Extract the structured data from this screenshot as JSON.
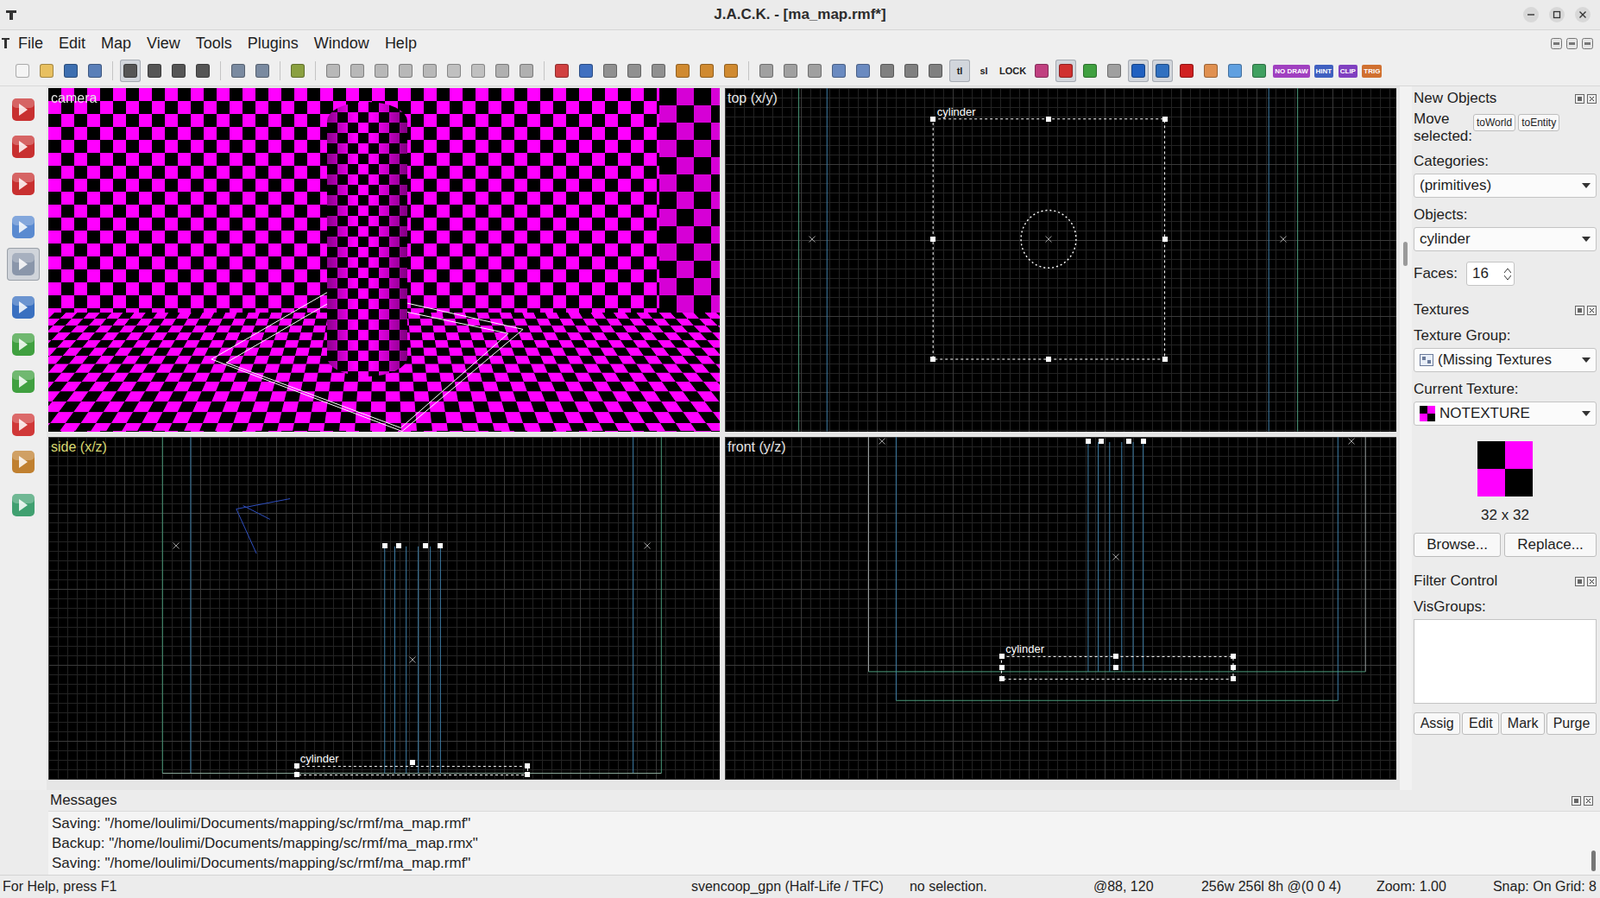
{
  "window": {
    "title": "J.A.C.K. - [ma_map.rmf*]"
  },
  "menu": [
    "File",
    "Edit",
    "Map",
    "View",
    "Tools",
    "Plugins",
    "Window",
    "Help"
  ],
  "toolbar": [
    {
      "kind": "icon",
      "color": "#f4f4f4",
      "selected": false
    },
    {
      "kind": "icon",
      "color": "#e8c060",
      "selected": false
    },
    {
      "kind": "icon",
      "color": "#3d6fb0",
      "selected": false
    },
    {
      "kind": "icon",
      "color": "#5a7fb8",
      "selected": false
    },
    {
      "kind": "sep"
    },
    {
      "kind": "icon",
      "color": "#555555",
      "selected": true
    },
    {
      "kind": "icon",
      "color": "#555555",
      "selected": false
    },
    {
      "kind": "icon",
      "color": "#555555",
      "selected": false
    },
    {
      "kind": "icon",
      "color": "#555555",
      "selected": false
    },
    {
      "kind": "sep"
    },
    {
      "kind": "icon",
      "color": "#7a8aa0",
      "selected": false
    },
    {
      "kind": "icon",
      "color": "#7a8aa0",
      "selected": false
    },
    {
      "kind": "sep"
    },
    {
      "kind": "icon",
      "color": "#8aa040",
      "selected": false
    },
    {
      "kind": "sep"
    },
    {
      "kind": "icon",
      "color": "#b8b8b8",
      "selected": false
    },
    {
      "kind": "icon",
      "color": "#b8b8b8",
      "selected": false
    },
    {
      "kind": "icon",
      "color": "#b8b8b8",
      "selected": false
    },
    {
      "kind": "icon",
      "color": "#b8b8b8",
      "selected": false
    },
    {
      "kind": "icon",
      "color": "#b8b8b8",
      "selected": false
    },
    {
      "kind": "icon",
      "color": "#c0c0c0",
      "selected": false
    },
    {
      "kind": "icon",
      "color": "#c0c0c0",
      "selected": false
    },
    {
      "kind": "icon",
      "color": "#b0b0b0",
      "selected": false
    },
    {
      "kind": "icon",
      "color": "#b0b0b0",
      "selected": false
    },
    {
      "kind": "sep"
    },
    {
      "kind": "icon",
      "color": "#d04040",
      "selected": false
    },
    {
      "kind": "icon",
      "color": "#4070c0",
      "selected": false
    },
    {
      "kind": "icon",
      "color": "#909090",
      "selected": false
    },
    {
      "kind": "icon",
      "color": "#909090",
      "selected": false
    },
    {
      "kind": "icon",
      "color": "#909090",
      "selected": false
    },
    {
      "kind": "icon",
      "color": "#d08a30",
      "selected": false
    },
    {
      "kind": "icon",
      "color": "#d08a30",
      "selected": false
    },
    {
      "kind": "icon",
      "color": "#d08a30",
      "selected": false
    },
    {
      "kind": "sep"
    },
    {
      "kind": "icon",
      "color": "#a0a0a0",
      "selected": false
    },
    {
      "kind": "icon",
      "color": "#a0a0a0",
      "selected": false
    },
    {
      "kind": "icon",
      "color": "#a0a0a0",
      "selected": false
    },
    {
      "kind": "icon",
      "color": "#6a8ac0",
      "selected": false
    },
    {
      "kind": "icon",
      "color": "#6a8ac0",
      "selected": false
    },
    {
      "kind": "icon",
      "color": "#808080",
      "selected": false
    },
    {
      "kind": "icon",
      "color": "#808080",
      "selected": false
    },
    {
      "kind": "icon",
      "color": "#808080",
      "selected": false
    },
    {
      "kind": "glyph",
      "label": "tl",
      "color": "#222222",
      "selected": true
    },
    {
      "kind": "glyph",
      "label": "sl",
      "color": "#222222",
      "selected": false
    },
    {
      "kind": "glyph",
      "label": "LOCK",
      "color": "#222222",
      "selected": false
    },
    {
      "kind": "icon",
      "color": "#c04080",
      "selected": false
    },
    {
      "kind": "icon",
      "color": "#d03030",
      "selected": true
    },
    {
      "kind": "icon",
      "color": "#40a040",
      "selected": false
    },
    {
      "kind": "icon",
      "color": "#a0a0a0",
      "selected": false
    },
    {
      "kind": "icon",
      "color": "#2060c0",
      "selected": true
    },
    {
      "kind": "icon",
      "color": "#3070c0",
      "selected": true
    },
    {
      "kind": "icon",
      "color": "#d02020",
      "selected": false
    },
    {
      "kind": "icon",
      "color": "#e09050",
      "selected": false
    },
    {
      "kind": "icon",
      "color": "#60a0e0",
      "selected": false
    },
    {
      "kind": "icon",
      "color": "#40a060",
      "selected": false
    },
    {
      "kind": "badge",
      "label": "NO DRAW",
      "color": "#a040c0",
      "selected": false
    },
    {
      "kind": "badge",
      "label": "HINT",
      "color": "#4060c0",
      "selected": false
    },
    {
      "kind": "badge",
      "label": "CLIP",
      "color": "#8040c0",
      "selected": false
    },
    {
      "kind": "badge",
      "label": "TRIG",
      "color": "#d07030",
      "selected": false
    }
  ],
  "tools": [
    [
      {
        "color": "#c83030",
        "selected": false
      },
      {
        "color": "#c83030",
        "selected": false
      },
      {
        "color": "#c83030",
        "selected": false
      }
    ],
    [
      {
        "color": "#5a8ad0",
        "selected": false
      },
      {
        "color": "#8a96aa",
        "selected": true
      }
    ],
    [
      {
        "color": "#3a70c0",
        "selected": false
      },
      {
        "color": "#40a040",
        "selected": false
      },
      {
        "color": "#40a040",
        "selected": false
      }
    ],
    [
      {
        "color": "#d03838",
        "selected": false
      },
      {
        "color": "#c08030",
        "selected": false
      }
    ],
    [
      {
        "color": "#40a070",
        "selected": false
      }
    ]
  ],
  "viewports": [
    {
      "kind": "camera",
      "label": "camera",
      "active": false
    },
    {
      "kind": "top",
      "label": "top (x/y)",
      "object_label": "cylinder",
      "active": false
    },
    {
      "kind": "side",
      "label": "side (x/z)",
      "object_label": "cylinder",
      "active": true
    },
    {
      "kind": "front",
      "label": "front (y/z)",
      "object_label": "cylinder",
      "active": false
    }
  ],
  "new_objects": {
    "title": "New Objects",
    "move_label": "Move selected:",
    "move_buttons": [
      "toWorld",
      "toEntity"
    ],
    "categories_label": "Categories:",
    "category": "(primitives)",
    "objects_label": "Objects:",
    "object": "cylinder",
    "faces_label": "Faces:",
    "faces": "16"
  },
  "textures": {
    "title": "Textures",
    "group_label": "Texture Group:",
    "group": "(Missing Textures",
    "current_label": "Current Texture:",
    "current": "NOTEXTURE",
    "size": "32 x 32",
    "buttons": [
      "Browse...",
      "Replace..."
    ]
  },
  "filter": {
    "title": "Filter Control",
    "visgroups_label": "VisGroups:",
    "buttons": [
      "Assig",
      "Edit",
      "Mark",
      "Purge"
    ]
  },
  "messages": {
    "title": "Messages",
    "lines": [
      "Saving: \"/home/loulimi/Documents/mapping/sc/rmf/ma_map.rmf\"",
      "Backup: \"/home/loulimi/Documents/mapping/sc/rmf/ma_map.rmx\"",
      "Saving: \"/home/loulimi/Documents/mapping/sc/rmf/ma_map.rmf\""
    ]
  },
  "status_bar": [
    "For Help, press F1",
    "svencoop_gpn (Half-Life / TFC)",
    "no selection.",
    "@88, 120",
    "256w 256l 8h @(0 0 4)",
    "Zoom: 1.00",
    "Snap: On Grid: 8"
  ]
}
